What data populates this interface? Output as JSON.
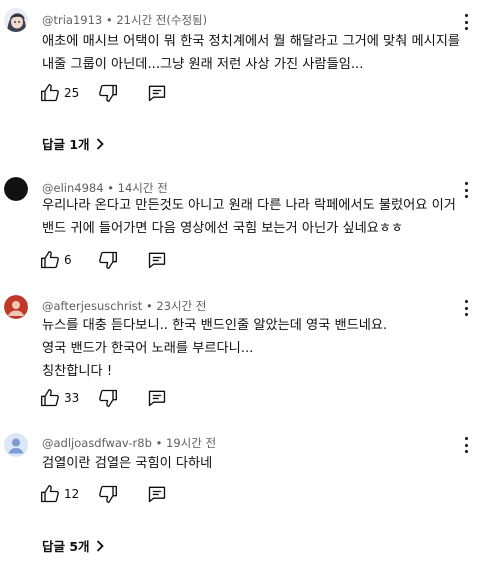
{
  "comments": [
    {
      "handle": "@tria1913",
      "time": "21시간 전(수정됨)",
      "text": "애초에 매시브 어택이 뭐 한국 정치계에서 뭘 해달라고 그거에 맞춰 메시지를\n내줄 그룹이 아닌데...그냥 원래 저런 사상 가진 사람들임...",
      "likes": "25",
      "replies": "답글 1개",
      "avatar_icon": "anime-character-avatar-icon"
    },
    {
      "handle": "@elin4984",
      "time": "14시간 전",
      "text": "우리나라 온다고 만든것도 아니고 원래 다른 나라 락페에서도 불렀어요 이거\n밴드 귀에 들어가면 다음 영상에선 국힘 보는거 아닌가 싶네요ㅎㅎ",
      "likes": "6",
      "avatar_icon": "black-circle-avatar-icon"
    },
    {
      "handle": "@afterjesuschrist",
      "time": "23시간 전",
      "text": "뉴스를 대충 듣다보니.. 한국 밴드인줄 알았는데 영국 밴드네요.\n영국 밴드가 한국어 노래를 부르다니...\n칭찬합니다 !",
      "likes": "33",
      "avatar_icon": "red-avatar-icon"
    },
    {
      "handle": "@adljoasdfwav-r8b",
      "time": "19시간 전",
      "text": "검열이란 검열은 국힘이 다하네",
      "likes": "12",
      "replies": "답글 5개",
      "avatar_icon": "blue-person-avatar-icon"
    }
  ],
  "colors": {
    "text": "#0f0f0f",
    "meta": "#606060",
    "avatar_black": "#111111",
    "avatar_red": "#c0392b",
    "avatar_blue": "#dbe6f6"
  }
}
